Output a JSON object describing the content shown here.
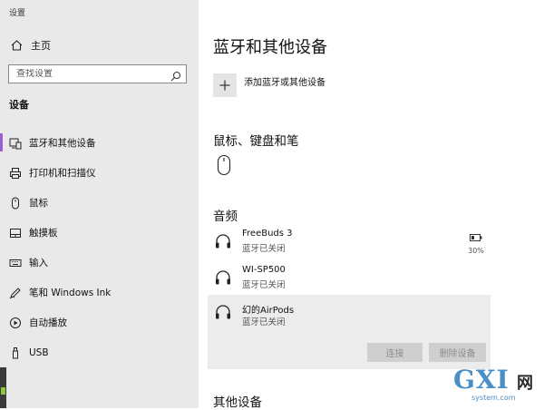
{
  "app": {
    "title": "设置"
  },
  "sidebar": {
    "home_label": "主页",
    "search_placeholder": "查找设置",
    "section_title": "设备",
    "items": [
      {
        "label": "蓝牙和其他设备",
        "icon": "bluetooth-devices-icon",
        "active": true
      },
      {
        "label": "打印机和扫描仪",
        "icon": "printer-icon"
      },
      {
        "label": "鼠标",
        "icon": "mouse-icon"
      },
      {
        "label": "触摸板",
        "icon": "touchpad-icon"
      },
      {
        "label": "输入",
        "icon": "keyboard-icon"
      },
      {
        "label": "笔和 Windows Ink",
        "icon": "pen-icon"
      },
      {
        "label": "自动播放",
        "icon": "autoplay-icon"
      },
      {
        "label": "USB",
        "icon": "usb-icon"
      }
    ]
  },
  "main": {
    "title": "蓝牙和其他设备",
    "add_device_label": "添加蓝牙或其他设备",
    "mouse_section_title": "鼠标、键盘和笔",
    "audio_section_title": "音频",
    "audio_devices": [
      {
        "name": "FreeBuds 3",
        "status": "蓝牙已关闭",
        "battery": "30%"
      },
      {
        "name": "WI-SP500",
        "status": "蓝牙已关闭"
      },
      {
        "name": "幻的AirPods",
        "status": "蓝牙已关闭"
      }
    ],
    "connect_label": "连接",
    "remove_label": "删除设备",
    "other_section_title": "其他设备"
  },
  "watermark": {
    "main": "GXI",
    "net": "网",
    "domain": "system.com"
  },
  "colors": {
    "sidebar_bg": "#e9e9e9",
    "accent": "#9c5fd3",
    "watermark": "#4a8fc6"
  }
}
